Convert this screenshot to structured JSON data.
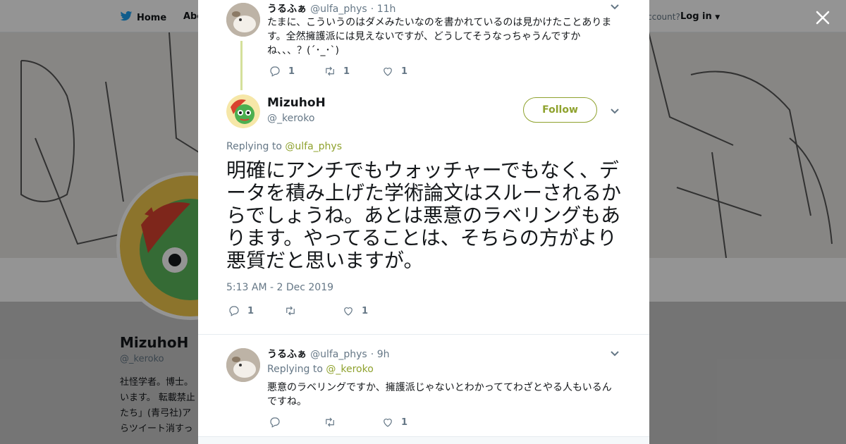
{
  "background": {
    "nav": {
      "home_label": "Home",
      "about_label": "Abo",
      "account_prompt": "ccount?",
      "login_label": "Log in"
    },
    "profile": {
      "name": "MizuhoH",
      "handle": "@_keroko",
      "bio": "社怪学者。博士。\nいます。 転載禁止\nたち」(青弓社)ア\nらツイート消すっ"
    }
  },
  "modal": {
    "parent_tweet": {
      "display_name": "うるふぁ",
      "handle": "@ulfa_phys",
      "time": "· 11h",
      "text": "たまに、こういうのはダメみたいなのを書かれているのは見かけたことあります。全然擁護派には見えないですが、どうしてそうなっちゃうんですかね、、、？(´･_･`)",
      "reply_count": "1",
      "retweet_count": "1",
      "like_count": "1"
    },
    "main_tweet": {
      "display_name": "MizuhoH",
      "handle": "@_keroko",
      "follow_label": "Follow",
      "replying_to_label": "Replying to",
      "replying_to_handle": "@ulfa_phys",
      "text": "明確にアンチでもウォッチャーでもなく、データを積み上げた学術論文はスルーされるからでしょうね。あとは悪意のラベリングもあります。やってることは、そちらの方がより悪質だと思いますが。",
      "timestamp": "5:13 AM - 2 Dec 2019",
      "reply_count": "1",
      "like_count": "1"
    },
    "reply_tweet": {
      "display_name": "うるふぁ",
      "handle": "@ulfa_phys",
      "time": "· 9h",
      "replying_to_label": "Replying to",
      "replying_to_handle": "@_keroko",
      "text": "悪意のラベリングですか、擁護派じゃないとわかっててわざとやる人もいるんですね。",
      "like_count": "1"
    }
  },
  "colors": {
    "accent": "#8fa22e",
    "twitter_blue": "#1da1f2",
    "muted": "#657786"
  }
}
